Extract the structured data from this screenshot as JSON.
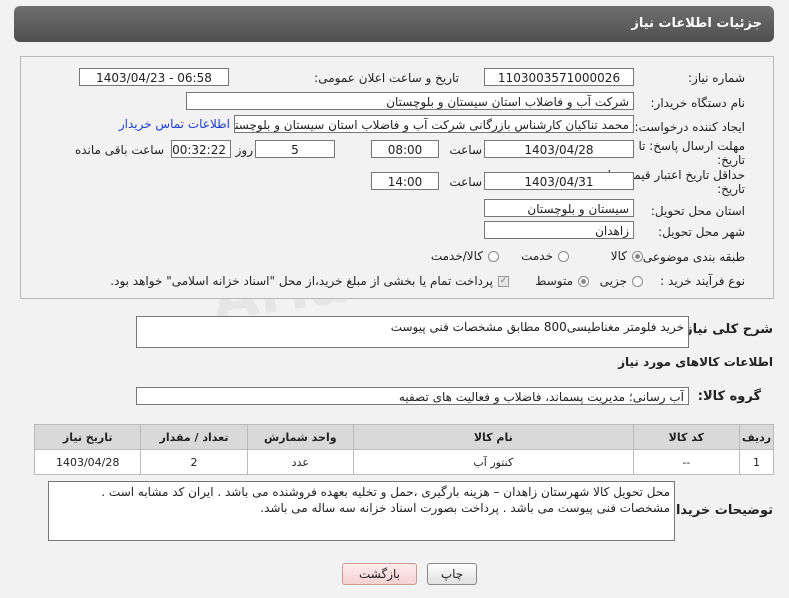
{
  "header": {
    "title": "جزئیات اطلاعات نیاز"
  },
  "form": {
    "need_number_label": "شماره نیاز:",
    "need_number": "1103003571000026",
    "announce_label": "تاریخ و ساعت اعلان عمومی:",
    "announce_value": "1403/04/23 - 06:58",
    "buyer_org_label": "نام دستگاه خریدار:",
    "buyer_org": "شرکت آب و فاضلاب استان سیستان و بلوچستان",
    "requester_label": "ایجاد کننده درخواست:",
    "requester": "محمد تناکیان کارشناس بازرگانی شرکت آب و فاضلاب استان سیستان و بلوچستان",
    "buyer_contact_link": "اطلاعات تماس خریدار",
    "deadline_label_1": "مهلت ارسال پاسخ: تا",
    "deadline_label_2": "تاریخ:",
    "deadline_date": "1403/04/28",
    "time_label": "ساعت",
    "deadline_time": "08:00",
    "days_value": "5",
    "days_label": "روز و",
    "remaining_time": "00:32:22",
    "remaining_label": "ساعت باقی مانده",
    "validity_label_1": "حداقل تاریخ اعتبار قیمت: تا",
    "validity_label_2": "تاریخ:",
    "validity_date": "1403/04/31",
    "validity_time_label": "ساعت",
    "validity_time": "14:00",
    "province_label": "استان محل تحویل:",
    "province": "سیستان و بلوچستان",
    "city_label": "شهر محل تحویل:",
    "city": "زاهدان",
    "category_label": "طبقه بندی موضوعی:",
    "category_options": [
      "کالا",
      "خدمت",
      "کالا/خدمت"
    ],
    "category_selected": "کالا",
    "process_label": "نوع فرآیند خرید :",
    "process_options": [
      "جزیی",
      "متوسط"
    ],
    "payment_note": "پرداخت تمام یا بخشی از مبلغ خرید،از محل \"اسناد خزانه اسلامی\" خواهد بود."
  },
  "summary": {
    "label": "شرح کلی نیاز:",
    "text": "خرید فلومتر مغناطیسی800 مطابق مشخصات فنی پیوست"
  },
  "goods_info_title": "اطلاعات کالاهای مورد نیاز",
  "goods_group": {
    "label": "گروه کالا:",
    "value": "آب رسانی؛ مدیریت پسماند، فاضلاب و فعالیت های تصفیه"
  },
  "table": {
    "headers": [
      "ردیف",
      "کد کالا",
      "نام کالا",
      "واحد شمارش",
      "تعداد / مقدار",
      "تاریخ نیاز"
    ],
    "rows": [
      [
        "1",
        "--",
        "کنتور آب",
        "عدد",
        "2",
        "1403/04/28"
      ]
    ]
  },
  "buyer_notes": {
    "label": "توضیحات خریدار:",
    "text": "محل تحویل کالا شهرستان زاهدان – هزینه بارگیری ،حمل و تخلیه بعهده فروشنده می باشد . ایران کد مشابه است . مشخصات فنی پیوست می باشد . پرداخت بصورت اسناد خزانه  سه ساله می باشد."
  },
  "buttons": {
    "print": "چاپ",
    "back": "بازگشت"
  },
  "watermark": "AriaTender.neT"
}
